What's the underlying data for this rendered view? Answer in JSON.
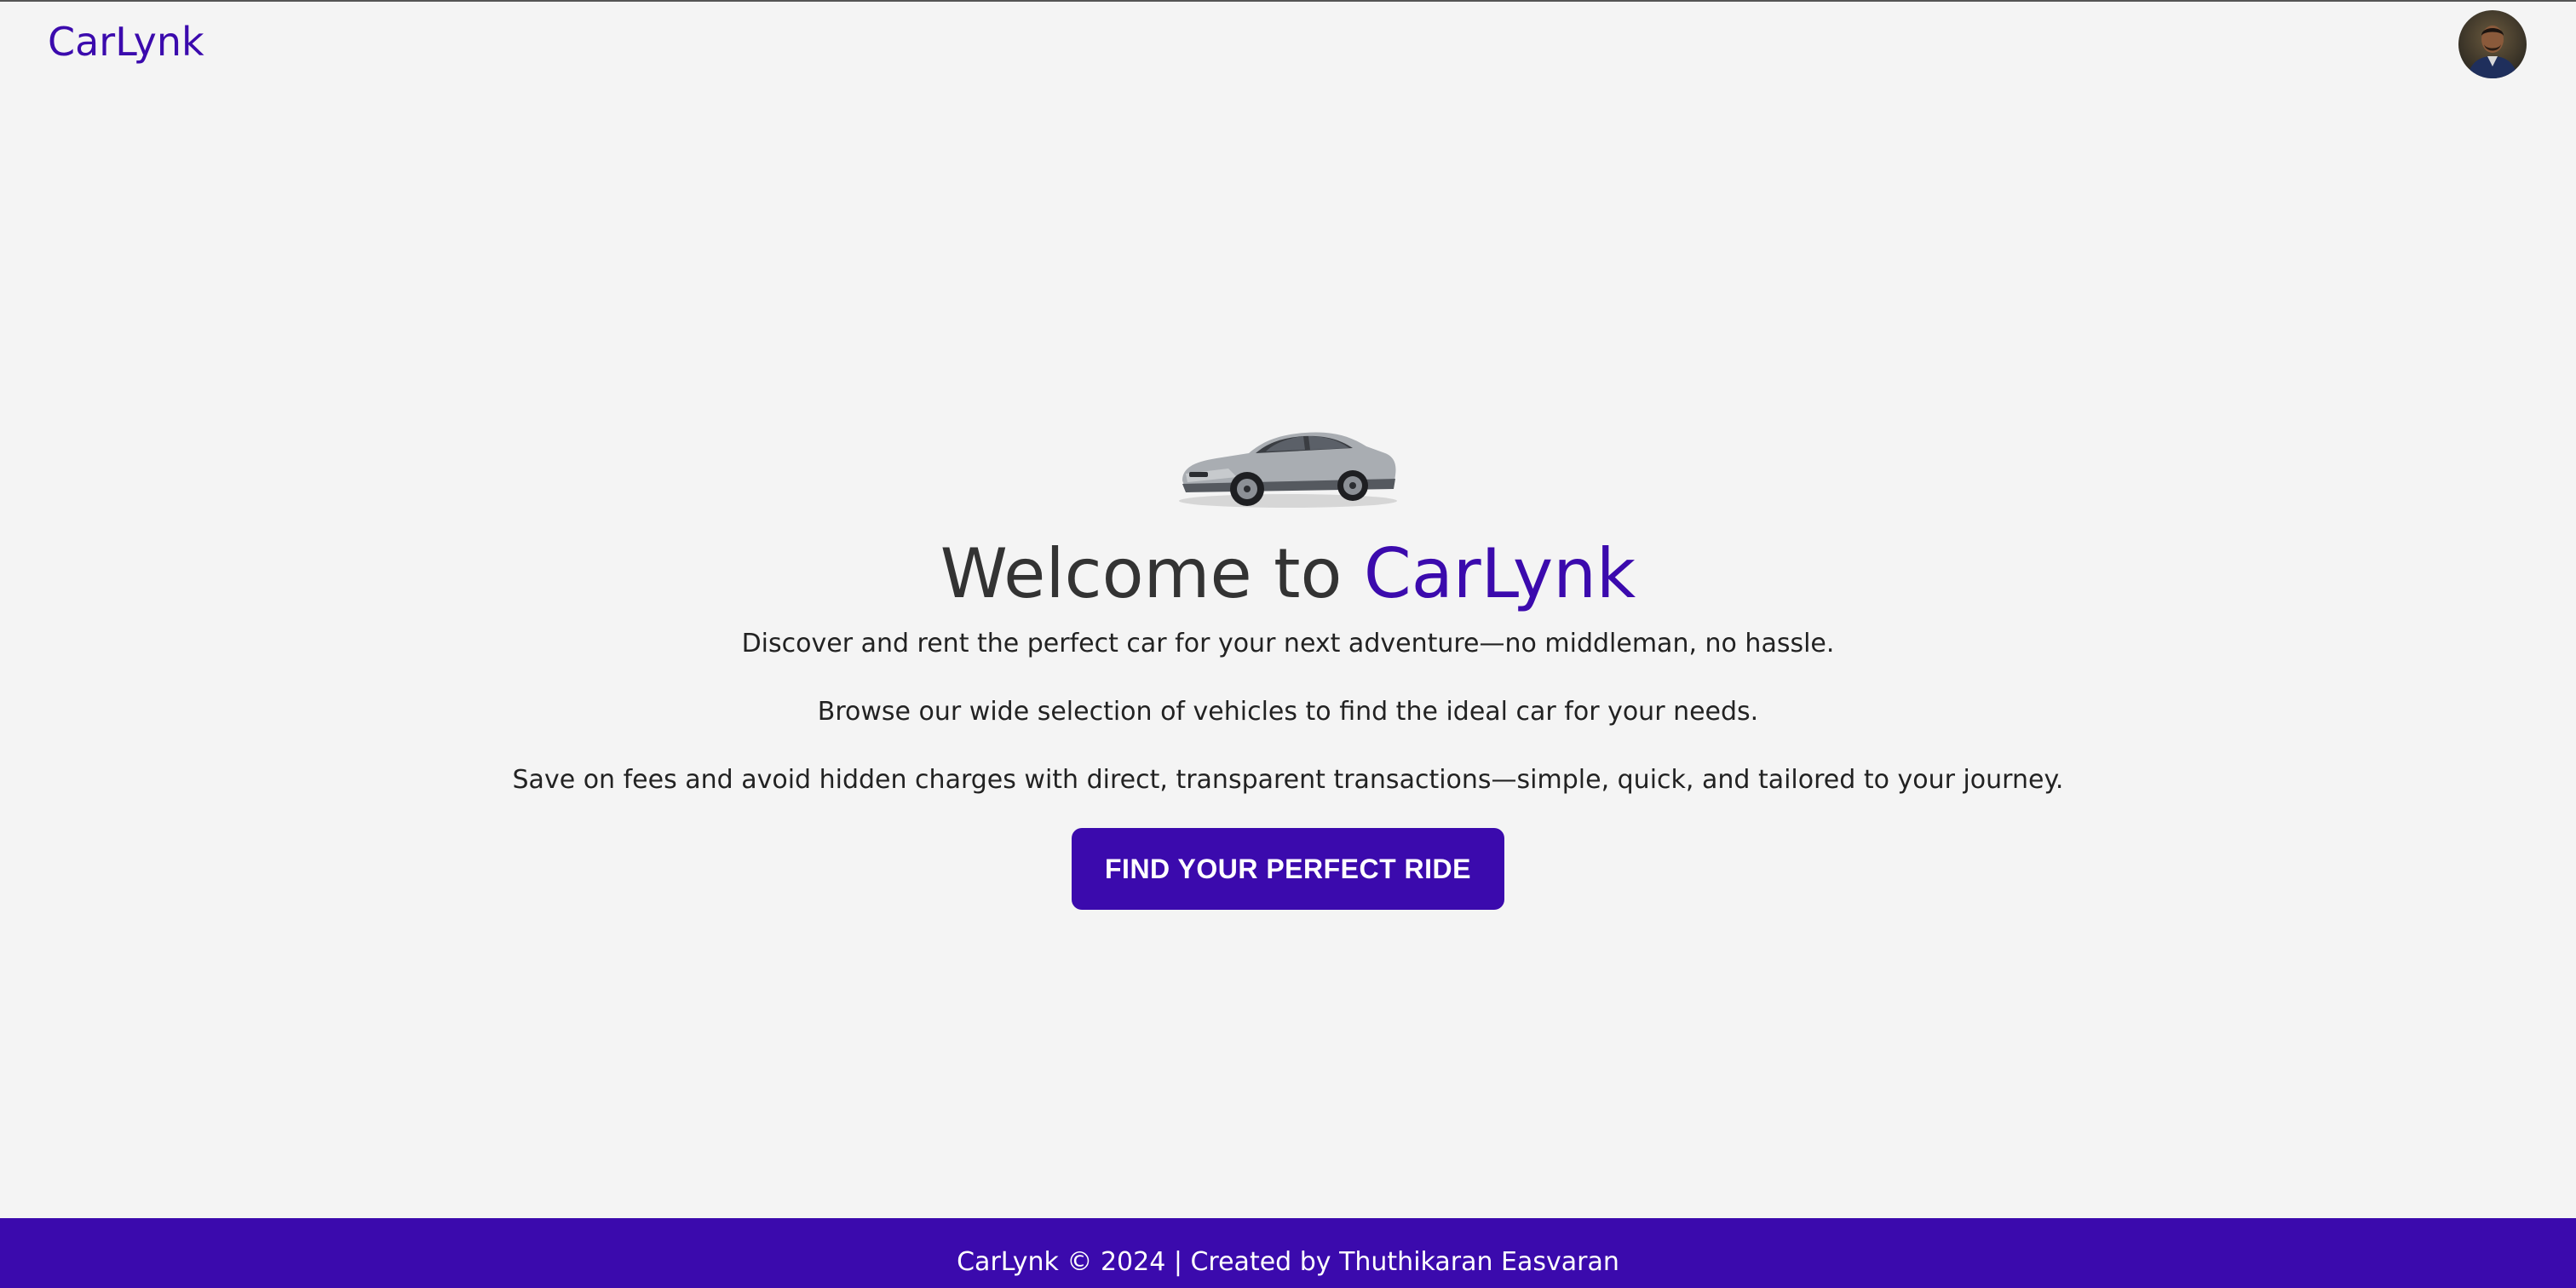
{
  "header": {
    "brand": "CarLynk",
    "avatar_icon": "user-avatar-photo"
  },
  "hero": {
    "car_image_icon": "silver-sedan-car-image",
    "headline_prefix": "Welcome to ",
    "headline_brand": "CarLynk",
    "tagline_1": "Discover and rent the perfect car for your next adventure—no middleman, no hassle.",
    "tagline_2": "Browse our wide selection of vehicles to find the ideal car for your needs.",
    "tagline_3": "Save on fees and avoid hidden charges with direct, transparent transactions—simple, quick, and tailored to your journey.",
    "cta_label": "FIND YOUR PERFECT RIDE"
  },
  "footer": {
    "text": "CarLynk © 2024 | Created by Thuthikaran Easvaran"
  },
  "colors": {
    "brand": "#3b0aad",
    "background": "#f4f4f4",
    "headline": "#333333",
    "body_text": "#222222",
    "footer_text": "#ffffff"
  }
}
